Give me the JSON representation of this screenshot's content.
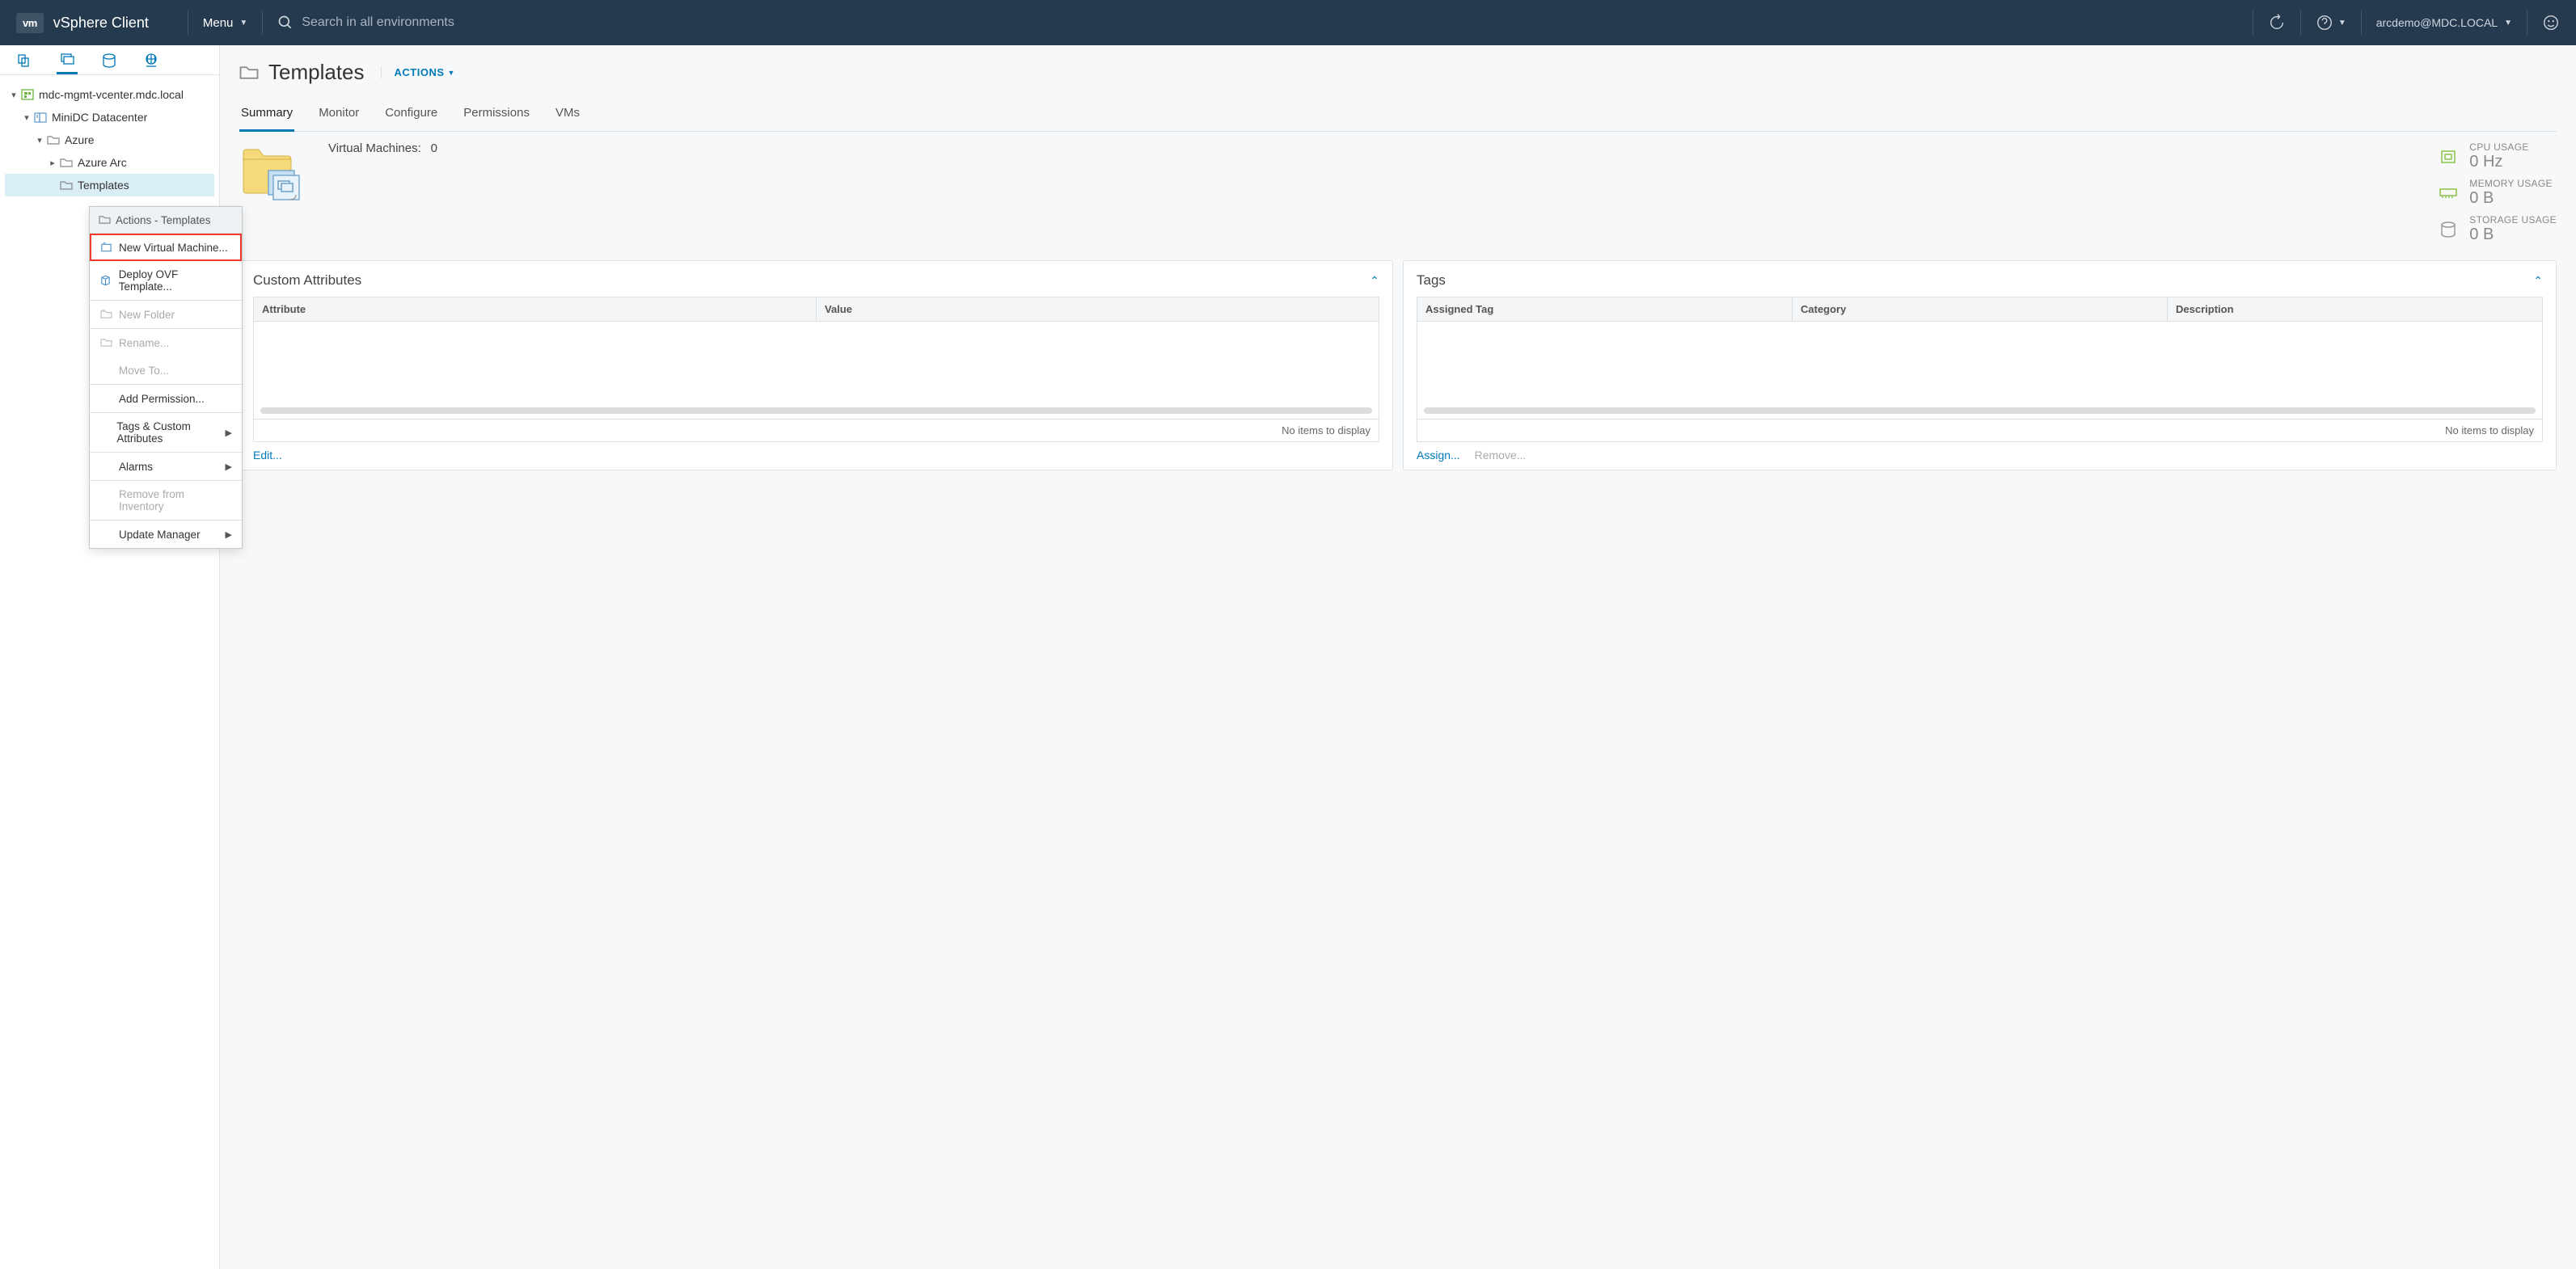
{
  "header": {
    "app_title": "vSphere Client",
    "logo_text": "vm",
    "menu_label": "Menu",
    "search_placeholder": "Search in all environments",
    "user": "arcdemo@MDC.LOCAL"
  },
  "tree": {
    "root": "mdc-mgmt-vcenter.mdc.local",
    "datacenter": "MiniDC Datacenter",
    "folder1": "Azure",
    "folder2": "Azure Arc",
    "folder3": "Templates"
  },
  "context_menu": {
    "title": "Actions - Templates",
    "items": [
      {
        "label": "New Virtual Machine...",
        "enabled": true,
        "highlighted": true,
        "icon": "vm"
      },
      {
        "label": "Deploy OVF Template...",
        "enabled": true,
        "highlighted": false,
        "icon": "ovf"
      },
      {
        "label": "New Folder",
        "enabled": false,
        "highlighted": false,
        "icon": "folder-new"
      },
      {
        "label": "Rename...",
        "enabled": false,
        "highlighted": false,
        "icon": "folder"
      },
      {
        "label": "Move To...",
        "enabled": false,
        "highlighted": false
      },
      {
        "label": "Add Permission...",
        "enabled": true,
        "highlighted": false
      },
      {
        "label": "Tags & Custom Attributes",
        "enabled": true,
        "highlighted": false,
        "sub": true
      },
      {
        "label": "Alarms",
        "enabled": true,
        "highlighted": false,
        "sub": true
      },
      {
        "label": "Remove from Inventory",
        "enabled": false,
        "highlighted": false
      },
      {
        "label": "Update Manager",
        "enabled": true,
        "highlighted": false,
        "sub": true
      }
    ]
  },
  "main": {
    "title": "Templates",
    "actions_label": "ACTIONS",
    "tabs": [
      "Summary",
      "Monitor",
      "Configure",
      "Permissions",
      "VMs"
    ],
    "active_tab": "Summary",
    "vm_count_label": "Virtual Machines:",
    "vm_count": "0",
    "usage": [
      {
        "label": "CPU USAGE",
        "value": "0 Hz",
        "icon": "cpu"
      },
      {
        "label": "MEMORY USAGE",
        "value": "0 B",
        "icon": "mem"
      },
      {
        "label": "STORAGE USAGE",
        "value": "0 B",
        "icon": "disk"
      }
    ]
  },
  "panels": {
    "custom_attributes": {
      "title": "Custom Attributes",
      "cols": [
        "Attribute",
        "Value"
      ],
      "empty": "No items to display",
      "link": "Edit..."
    },
    "tags": {
      "title": "Tags",
      "cols": [
        "Assigned Tag",
        "Category",
        "Description"
      ],
      "empty": "No items to display",
      "link1": "Assign...",
      "link2": "Remove..."
    }
  }
}
